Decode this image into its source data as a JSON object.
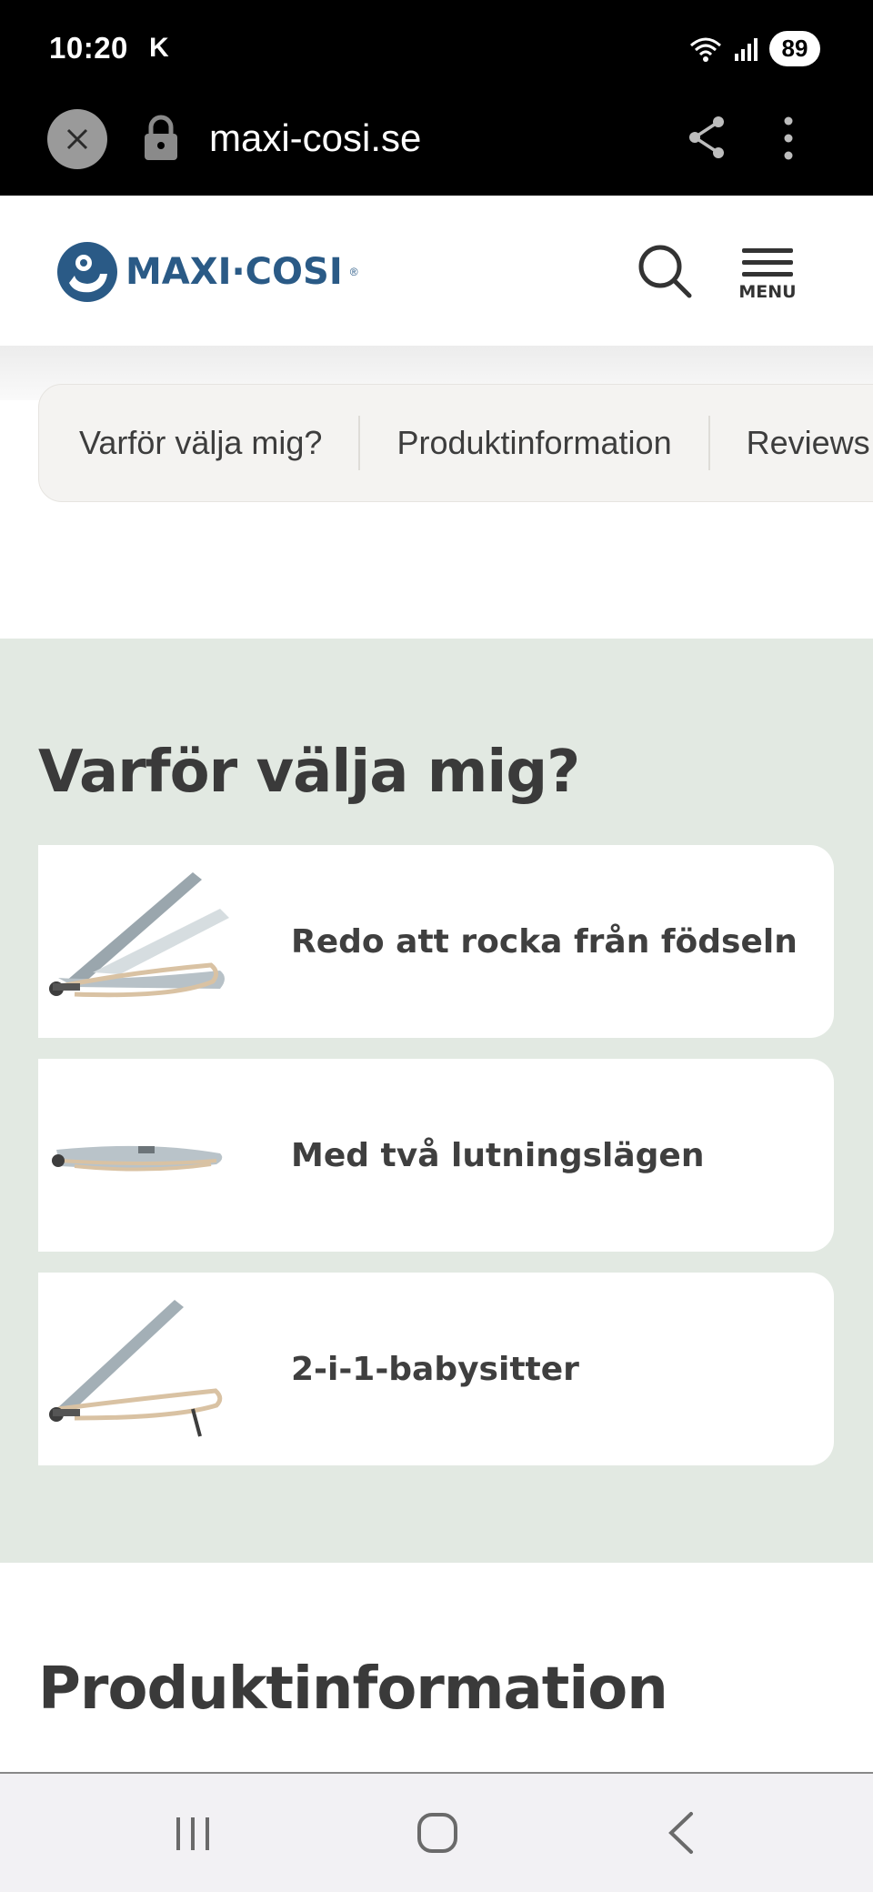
{
  "status_bar": {
    "time": "10:20",
    "carrier_letter": "K",
    "battery": "89"
  },
  "browser": {
    "url": "maxi-cosi.se"
  },
  "header": {
    "logo_text": "MAXI·COSI",
    "logo_reg": "®",
    "menu_label": "MENU"
  },
  "tabs": [
    {
      "label": "Varför välja mig?"
    },
    {
      "label": "Produktinformation"
    },
    {
      "label": "Reviews"
    }
  ],
  "why": {
    "title": "Varför välja mig?",
    "features": [
      {
        "label": "Redo att rocka från födseln"
      },
      {
        "label": "Med två lutningslägen"
      },
      {
        "label": "2-i-1-babysitter"
      }
    ]
  },
  "product": {
    "title": "Produktinformation"
  },
  "colors": {
    "brand_blue": "#2a5a86",
    "section_bg": "#e2e9e2",
    "tab_bg": "#f4f3f1"
  }
}
